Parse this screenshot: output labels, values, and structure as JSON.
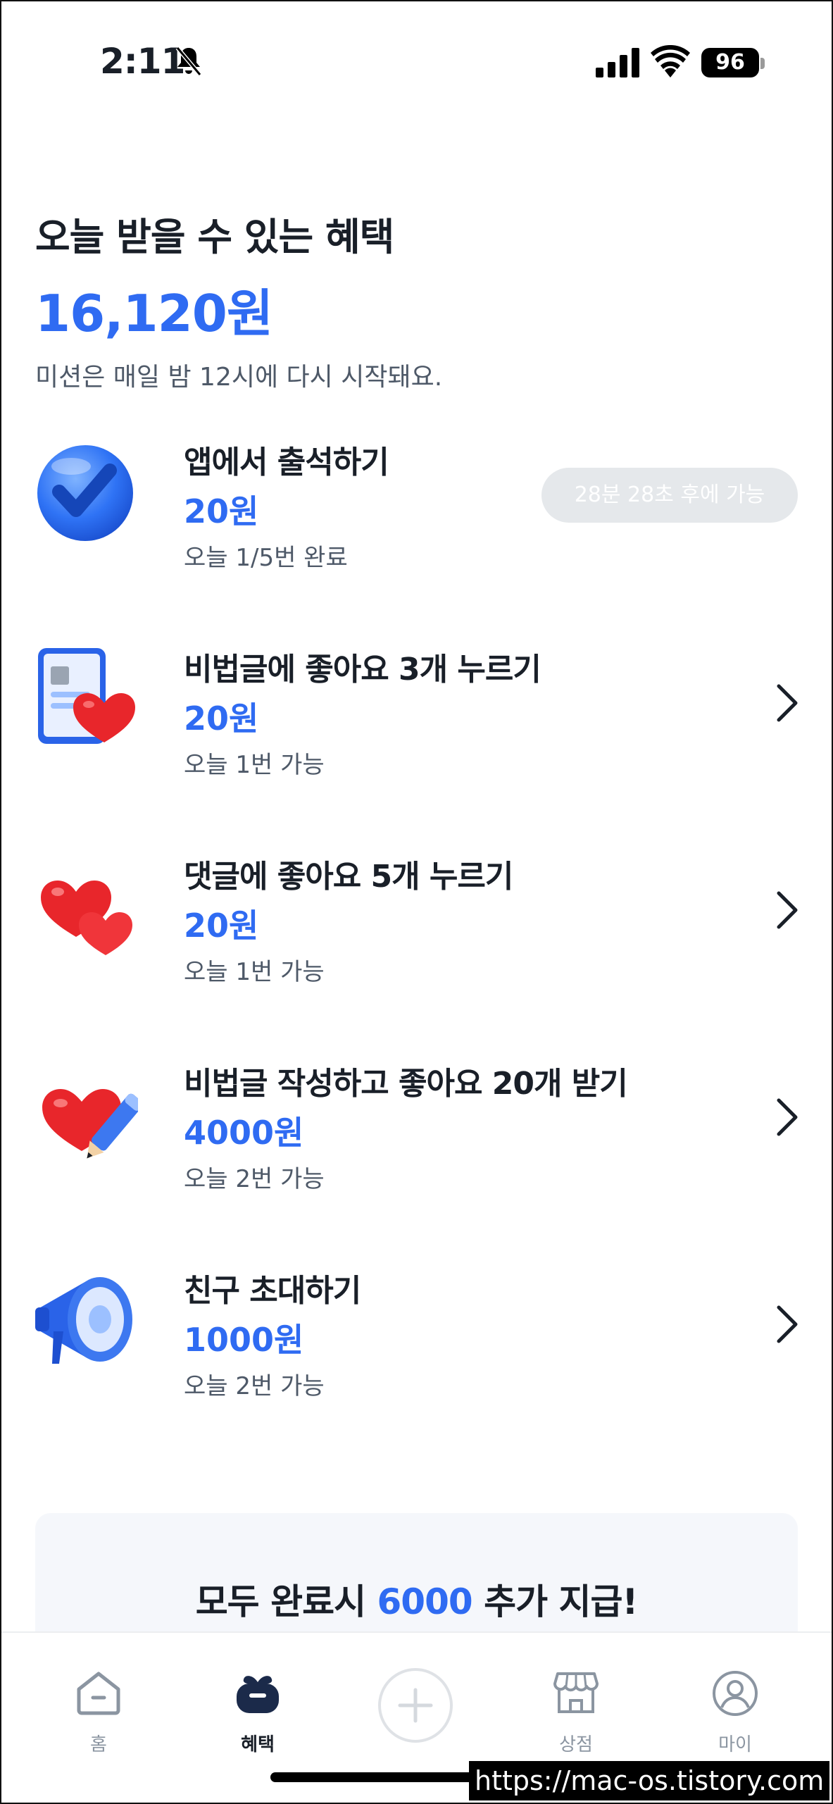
{
  "status_bar": {
    "time": "2:11",
    "battery": "96"
  },
  "header": {
    "title": "오늘 받을 수 있는 혜택",
    "total": "16,120원",
    "subtitle": "미션은 매일 밤 12시에 다시 시작돼요."
  },
  "missions": [
    {
      "icon": "checkmark-icon",
      "title": "앱에서 출석하기",
      "reward": "20원",
      "status": "오늘 1/5번 완료",
      "action": "28분 28초 후에 가능"
    },
    {
      "icon": "post-heart-icon",
      "title": "비법글에 좋아요 3개 누르기",
      "reward": "20원",
      "status": "오늘 1번 가능"
    },
    {
      "icon": "two-hearts-icon",
      "title": "댓글에 좋아요 5개 누르기",
      "reward": "20원",
      "status": "오늘 1번 가능"
    },
    {
      "icon": "heart-pen-icon",
      "title": "비법글 작성하고 좋아요 20개 받기",
      "reward": "4000원",
      "status": "오늘 2번 가능"
    },
    {
      "icon": "megaphone-icon",
      "title": "친구 초대하기",
      "reward": "1000원",
      "status": "오늘 2번 가능"
    }
  ],
  "bonus": {
    "prefix": "모두 완료시 ",
    "amount": "6000",
    "suffix": " 추가 지급!"
  },
  "tab_bar": {
    "tabs": [
      {
        "label": "홈",
        "icon": "home-icon"
      },
      {
        "label": "혜택",
        "icon": "gift-icon",
        "active": true
      },
      {
        "label": "",
        "icon": "plus-icon"
      },
      {
        "label": "상점",
        "icon": "store-icon"
      },
      {
        "label": "마이",
        "icon": "profile-icon"
      }
    ]
  },
  "watermark": "https://mac-os.tistory.com",
  "colors": {
    "accent": "#2f6bf2",
    "text": "#191f28",
    "muted": "#4e5968",
    "tab_inactive": "#8b95a1"
  }
}
